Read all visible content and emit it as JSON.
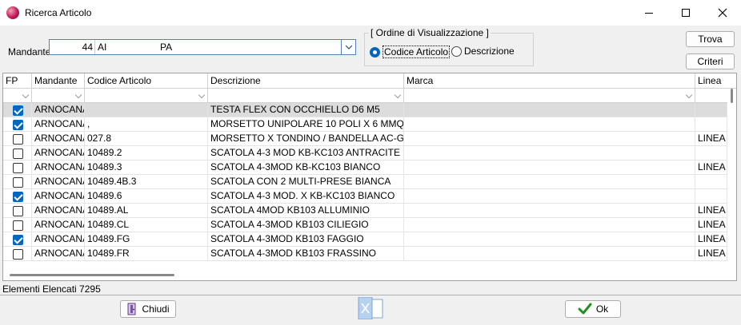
{
  "window": {
    "title": "Ricerca Articolo"
  },
  "mandante": {
    "label": "Mandante",
    "code": "44",
    "name": "AI",
    "name_suffix": "PA"
  },
  "ordine": {
    "title": "[ Ordine di Visualizzazione ]",
    "options": [
      {
        "label": "Codice Articolo",
        "selected": true
      },
      {
        "label": "Descrizione",
        "selected": false
      }
    ]
  },
  "buttons": {
    "trova": "Trova",
    "criteri": "Criteri",
    "chiudi": "Chiudi",
    "ok": "Ok"
  },
  "grid": {
    "columns": [
      "FP",
      "Mandante",
      "Codice Articolo",
      "Descrizione",
      "Marca",
      "Linea"
    ],
    "rows": [
      {
        "fp": true,
        "mandante": "ARNOCANA",
        "codice": "",
        "descrizione": "TESTA FLEX CON OCCHIELLO D6 M5",
        "marca": "",
        "linea": "",
        "selected": true
      },
      {
        "fp": true,
        "mandante": "ARNOCANA",
        "codice": ",",
        "descrizione": "MORSETTO UNIPOLARE 10 POLI X 6 MMQ",
        "marca": "",
        "linea": ""
      },
      {
        "fp": false,
        "mandante": "ARNOCANA",
        "codice": "027.8",
        "descrizione": "MORSETTO X TONDINO / BANDELLA AC-GC",
        "marca": "",
        "linea": "LINEA"
      },
      {
        "fp": false,
        "mandante": "ARNOCANA",
        "codice": "10489.2",
        "descrizione": "SCATOLA 4-3 MOD KB-KC103 ANTRACITE",
        "marca": "",
        "linea": ""
      },
      {
        "fp": false,
        "mandante": "ARNOCANA",
        "codice": "10489.3",
        "descrizione": "SCATOLA 4-3MOD KB-KC103 BIANCO",
        "marca": "",
        "linea": "LINEA"
      },
      {
        "fp": false,
        "mandante": "ARNOCANA",
        "codice": "10489.4B.3",
        "descrizione": "SCATOLA CON 2 MULTI-PRESE BIANCA",
        "marca": "",
        "linea": ""
      },
      {
        "fp": true,
        "mandante": "ARNOCANA",
        "codice": "10489.6",
        "descrizione": "SCATOLA 4-3 MOD. X KB-KC103 BIANCO",
        "marca": "",
        "linea": ""
      },
      {
        "fp": false,
        "mandante": "ARNOCANA",
        "codice": "10489.AL",
        "descrizione": "SCATOLA 4MOD KB103 ALLUMINIO",
        "marca": "",
        "linea": "LINEA"
      },
      {
        "fp": false,
        "mandante": "ARNOCANA",
        "codice": "10489.CL",
        "descrizione": "SCATOLA 4-3MOD KB103 CILIEGIO",
        "marca": "",
        "linea": "LINEA"
      },
      {
        "fp": true,
        "mandante": "ARNOCANA",
        "codice": "10489.FG",
        "descrizione": "SCATOLA 4-3MOD KB103 FAGGIO",
        "marca": "",
        "linea": "LINEA"
      },
      {
        "fp": false,
        "mandante": "ARNOCANA",
        "codice": "10489.FR",
        "descrizione": "SCATOLA 4-3MOD KB103 FRASSINO",
        "marca": "",
        "linea": "LINEA"
      }
    ]
  },
  "status": {
    "text": "Elementi Elencati 7295"
  },
  "icons": {
    "app": "app-logo-icon",
    "chiudi": "exit-door-icon",
    "ok": "checkmark-icon",
    "export": "excel-icon"
  },
  "colors": {
    "accent": "#0067c0",
    "selected_row": "#dcdcdc",
    "ok_check": "#1f8f1f"
  }
}
